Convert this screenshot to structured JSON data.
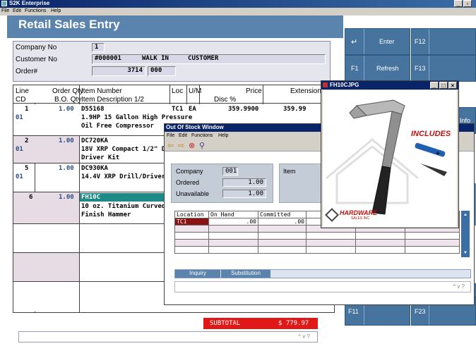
{
  "app": {
    "title": "S2K Enterprise",
    "menu": [
      "File",
      "Edit",
      "Functions",
      "Help"
    ]
  },
  "screen": {
    "title": "Retail Sales Entry"
  },
  "header": {
    "company_label": "Company No",
    "company_value": "1",
    "customer_label": "Customer No",
    "customer_value": "#000001",
    "customer_name": "WALK IN     CUSTOMER",
    "order_label": "Order#",
    "order_value": "3714",
    "order_suffix": "000"
  },
  "grid": {
    "headers": {
      "line": "Line",
      "cd": "CD",
      "order_qty": "Order Qty",
      "bo_qty": "B.O. Qty",
      "item_number": "Item Number",
      "item_desc": "Item Description 1/2",
      "loc": "Loc",
      "um": "U/M",
      "price": "Price",
      "disc": "Disc %",
      "extension": "Extension"
    },
    "rows": [
      {
        "line": "1",
        "cd": "01",
        "qty": "1.00",
        "item": "D55168",
        "desc1": "1.9HP 15 Gallon High Pressure",
        "desc2": "Oil Free Compressor",
        "loc": "TC1",
        "um": "EA",
        "price": "359.9900",
        "ext": "359.99"
      },
      {
        "line": "2",
        "cd": "01",
        "qty": "1.00",
        "item": "DC720KA",
        "desc1": "18V XRP Compact 1/2\" D",
        "desc2": "Driver Kit"
      },
      {
        "line": "5",
        "cd": "01",
        "qty": "1.00",
        "item": "DC930KA",
        "desc1": "14.4V XRP Drill/Driver"
      },
      {
        "line": "6",
        "cd": "",
        "qty": "1.00",
        "item": "FH10C",
        "desc1": "10 oz. Titanium Curved",
        "desc2": "Finish Hammer"
      }
    ]
  },
  "subtotal": {
    "label": "SUBTOTAL",
    "value": "$ 779.97"
  },
  "fkeys": {
    "enter": {
      "key": "↵",
      "label": "Enter"
    },
    "f12": "F12",
    "f1": {
      "key": "F1",
      "label": "Refresh"
    },
    "f13": "F13",
    "info": "Info",
    "f11": "F11",
    "f23": "F23"
  },
  "scroll": "^ v ?",
  "stock_window": {
    "title": "Out Of Stock Window",
    "menu": [
      "File",
      "Edit",
      "Functions",
      "Help"
    ],
    "company_label": "Company",
    "company_value": "001",
    "ordered_label": "Ordered",
    "ordered_value": "1.00",
    "unavail_label": "Unavailable",
    "unavail_value": "1.00",
    "item_label": "Item",
    "table_headers": [
      "Location",
      "On Hand",
      "Committed"
    ],
    "table_rows": [
      [
        "TC1",
        ".00",
        ".00"
      ]
    ],
    "tabs": [
      "Inquiry",
      "Substitution"
    ],
    "scroll": "^ v ?"
  },
  "image_window": {
    "title": "FH10CJPG",
    "includes_text": "INCLUDES",
    "brand_text": "HARDWARE",
    "brand_sub": "SALES INC"
  }
}
